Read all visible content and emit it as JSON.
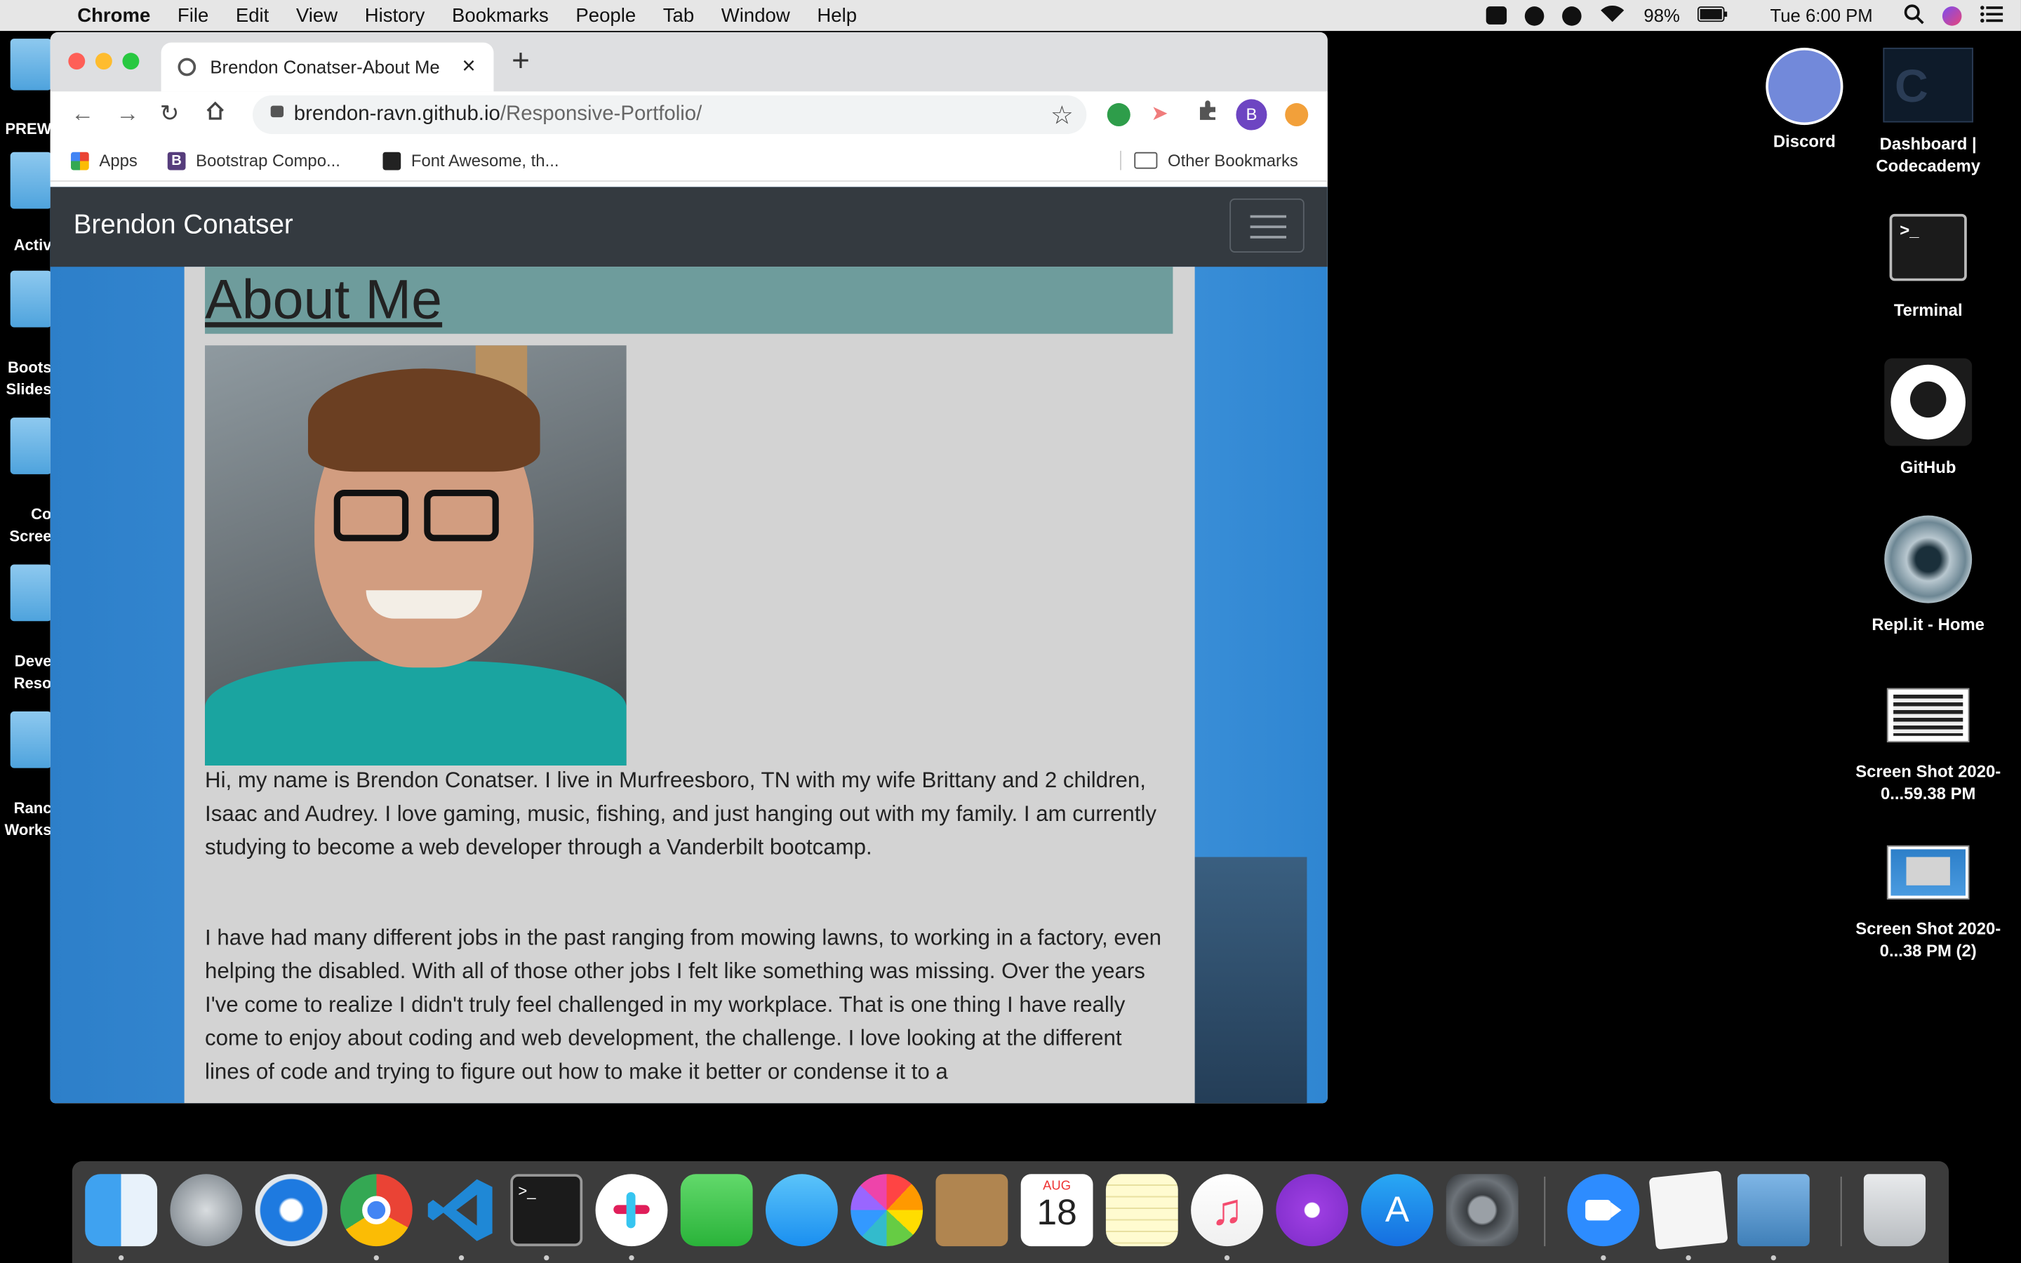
{
  "menubar": {
    "app": "Chrome",
    "items": [
      "File",
      "Edit",
      "View",
      "History",
      "Bookmarks",
      "People",
      "Tab",
      "Window",
      "Help"
    ],
    "battery": "98%",
    "clock": "Tue 6:00 PM"
  },
  "desktop_left": [
    "PREW",
    "Activ",
    "Boots Slides",
    "Co Scree",
    "Deve Reso",
    "Ranc Works"
  ],
  "desktop_right": [
    {
      "label": "Discord"
    },
    {
      "label": "Dashboard | Codecademy"
    },
    {
      "label": "Terminal"
    },
    {
      "label": "GitHub"
    },
    {
      "label": "Repl.it - Home"
    },
    {
      "label": "Screen Shot 2020-0...59.38 PM"
    },
    {
      "label": "Screen Shot 2020-0...38 PM (2)"
    }
  ],
  "browser": {
    "tab_title": "Brendon Conatser-About Me",
    "url_host": "brendon-ravn.github.io",
    "url_path": "/Responsive-Portfolio/",
    "profile_initial": "B",
    "bookmarks": [
      "Apps",
      "Bootstrap Compo...",
      "Font Awesome, th..."
    ],
    "other_bookmarks": "Other Bookmarks"
  },
  "page": {
    "brand": "Brendon Conatser",
    "heading": "About Me",
    "para1": "Hi, my name is Brendon Conatser. I live in Murfreesboro, TN with my wife Brittany and 2 children, Isaac and Audrey. I love gaming, music, fishing, and just hanging out with my family. I am currently studying to become a web developer through a Vanderbilt bootcamp.",
    "para2": "I have had many different jobs in the past ranging from mowing lawns, to working in a factory, even helping the disabled. With all of those other jobs I felt like something was missing. Over the years I've come to realize I didn't truly feel challenged in my workplace. That is one thing I have really come to enjoy about coding and web development, the challenge. I love looking at the different lines of code and trying to figure out how to make it better or condense it to a"
  },
  "calendar": {
    "month": "AUG",
    "day": "18"
  },
  "colors": {
    "navbar": "#343a40",
    "content_bg": "#d3d3d3",
    "heading_bar": "#6e9c9c",
    "page_bg": "#3b8fd8"
  }
}
